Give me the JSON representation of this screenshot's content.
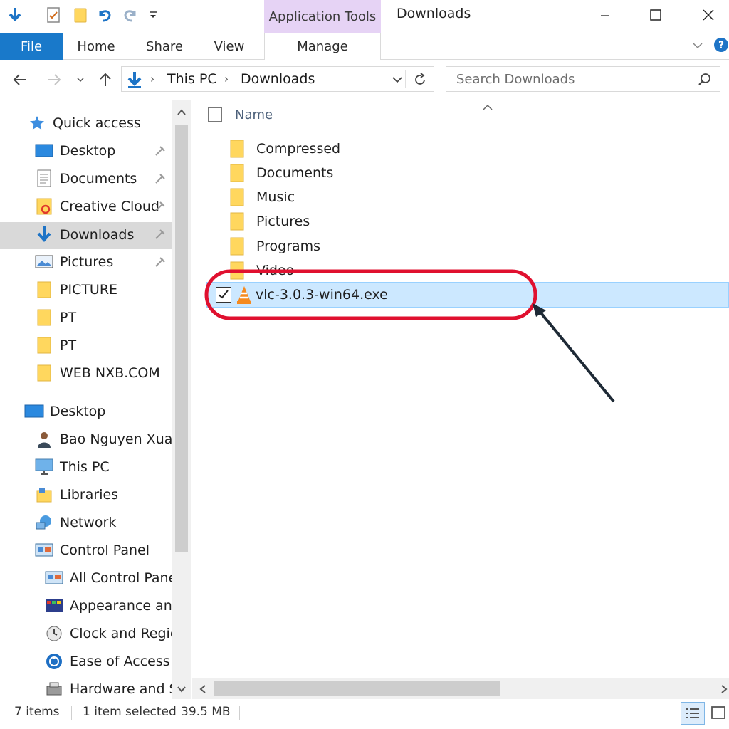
{
  "window": {
    "title": "Downloads",
    "context_tab": "Application Tools"
  },
  "ribbon": {
    "tabs": [
      "File",
      "Home",
      "Share",
      "View",
      "Manage"
    ]
  },
  "address": {
    "crumbs": [
      "This PC",
      "Downloads"
    ],
    "search_placeholder": "Search Downloads"
  },
  "nav": {
    "quick_access": "Quick access",
    "items": [
      {
        "label": "Desktop",
        "icon": "desktop-icon",
        "pinned": true
      },
      {
        "label": "Documents",
        "icon": "documents-icon",
        "pinned": true
      },
      {
        "label": "Creative Cloud",
        "icon": "creative-cloud-icon",
        "pinned": true
      },
      {
        "label": "Downloads",
        "icon": "downloads-icon",
        "pinned": true,
        "selected": true
      },
      {
        "label": "Pictures",
        "icon": "pictures-icon",
        "pinned": true
      },
      {
        "label": "PICTURE",
        "icon": "folder-icon",
        "pinned": false
      },
      {
        "label": "PT",
        "icon": "folder-icon",
        "pinned": false
      },
      {
        "label": "PT",
        "icon": "folder-icon",
        "pinned": false
      },
      {
        "label": "WEB NXB.COM",
        "icon": "folder-icon",
        "pinned": false
      }
    ],
    "tree": [
      {
        "label": "Desktop",
        "icon": "desktop-icon",
        "level": 0
      },
      {
        "label": "Bao Nguyen Xuan",
        "icon": "user-icon",
        "level": 1
      },
      {
        "label": "This PC",
        "icon": "this-pc-icon",
        "level": 1
      },
      {
        "label": "Libraries",
        "icon": "libraries-icon",
        "level": 1
      },
      {
        "label": "Network",
        "icon": "network-icon",
        "level": 1
      },
      {
        "label": "Control Panel",
        "icon": "control-panel-icon",
        "level": 1
      },
      {
        "label": "All Control Panel",
        "icon": "control-panel-icon",
        "level": 2
      },
      {
        "label": "Appearance and",
        "icon": "appearance-icon",
        "level": 2
      },
      {
        "label": "Clock and Regio",
        "icon": "clock-icon",
        "level": 2
      },
      {
        "label": "Ease of Access",
        "icon": "ease-of-access-icon",
        "level": 2
      },
      {
        "label": "Hardware and Sc",
        "icon": "hardware-icon",
        "level": 2
      }
    ]
  },
  "content": {
    "column_name": "Name",
    "folders": [
      "Compressed",
      "Documents",
      "Music",
      "Pictures",
      "Programs",
      "Video"
    ],
    "selected_file": "vlc-3.0.3-win64.exe"
  },
  "status": {
    "items_count": "7 items",
    "selection": "1 item selected",
    "size": "39.5 MB"
  },
  "colors": {
    "accent": "#1979ca",
    "context_tab": "#e6d3f5",
    "selection": "#cce8ff",
    "highlight_circle": "#e0102f"
  }
}
